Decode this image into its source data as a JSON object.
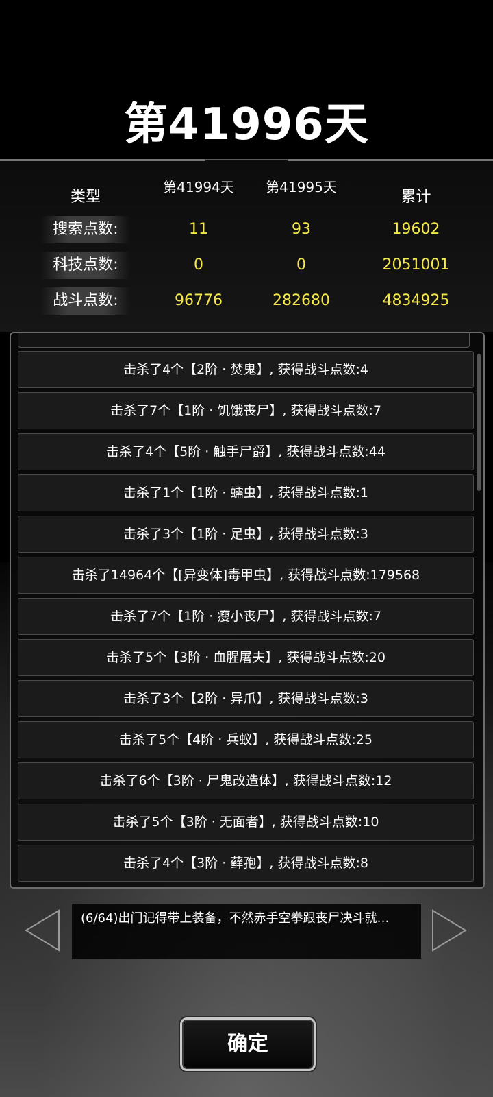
{
  "day_title": "第41996天",
  "stats": {
    "headers": [
      "类型",
      "第41994天",
      "第41995天",
      "累计"
    ],
    "rows": [
      {
        "label": "搜索点数:",
        "v1": "11",
        "v2": "93",
        "total": "19602"
      },
      {
        "label": "科技点数:",
        "v1": "0",
        "v2": "0",
        "total": "2051001"
      },
      {
        "label": "战斗点数:",
        "v1": "96776",
        "v2": "282680",
        "total": "4834925"
      }
    ]
  },
  "log": [
    "击杀了4个【2阶 · 焚鬼】, 获得战斗点数:4",
    "击杀了7个【1阶 · 饥饿丧尸】, 获得战斗点数:7",
    "击杀了4个【5阶 · 触手尸爵】, 获得战斗点数:44",
    "击杀了1个【1阶 · 蠕虫】, 获得战斗点数:1",
    "击杀了3个【1阶 · 足虫】, 获得战斗点数:3",
    "击杀了14964个【[异变体]毒甲虫】, 获得战斗点数:179568",
    "击杀了7个【1阶 · 瘦小丧尸】, 获得战斗点数:7",
    "击杀了5个【3阶 · 血腥屠夫】, 获得战斗点数:20",
    "击杀了3个【2阶 · 异爪】, 获得战斗点数:3",
    "击杀了5个【4阶 · 兵蚁】, 获得战斗点数:25",
    "击杀了6个【3阶 · 尸鬼改造体】, 获得战斗点数:12",
    "击杀了5个【3阶 · 无面者】, 获得战斗点数:10",
    "击杀了4个【3阶 · 藓孢】, 获得战斗点数:8"
  ],
  "tip": {
    "text": "(6/64)出门记得带上装备，不然赤手空拳跟丧尸决斗就…",
    "prev_icon": "left-triangle-icon",
    "next_icon": "right-triangle-icon"
  },
  "confirm_label": "确定",
  "colors": {
    "value": "#f5e94a",
    "frame": "#6d6d6d"
  }
}
